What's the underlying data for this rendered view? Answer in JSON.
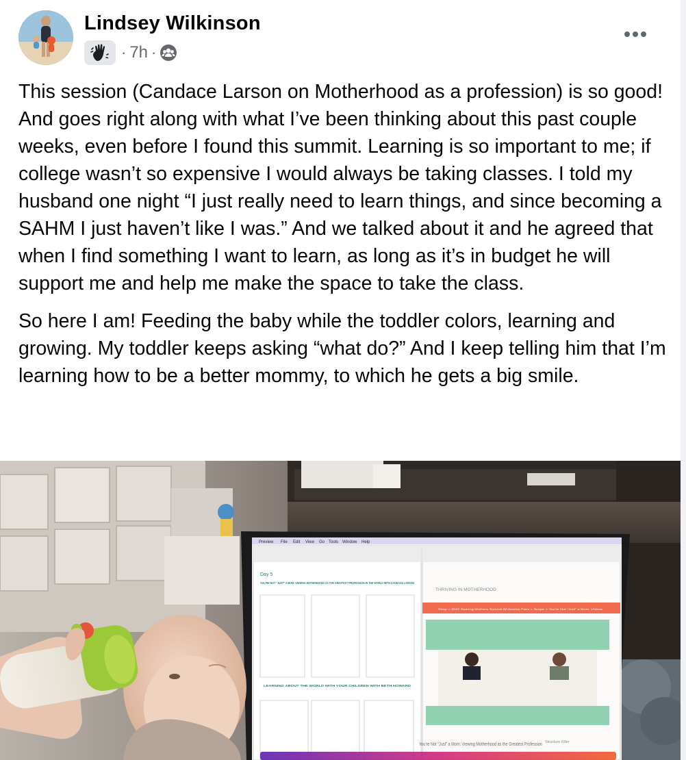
{
  "post": {
    "author": "Lindsey Wilkinson",
    "time": "7h",
    "separator": "·",
    "badge_icon": "wave-hand-icon",
    "audience_icon": "group-audience-icon",
    "menu_icon": "more-horizontal-icon",
    "paragraphs": [
      "This session (Candace Larson on Motherhood as a profession) is so good! And goes right along with what I’ve been thinking about this past couple weeks, even before I found this summit. Learning is so important to me; if college wasn’t so expensive I would always be taking classes. I told my husband one night “I just really need to learn things, and since becoming a SAHM I just haven’t like I was.” And we talked about it and he agreed that when I find something I want to learn, as long as it’s in budget he will support me and help me make the space to take the class.",
      "So here I am! Feeding the baby while the toddler colors, learning and growing. My toddler keeps asking “what do?” And I keep telling him that I’m learning how to be a better mommy, to which he gets a big smile."
    ]
  },
  "photo": {
    "workbook": {
      "day": "Day 5",
      "heading": "YOU’RE NOT “JUST” A MOM: VIEWING MOTHERHOOD AS THE GREATEST PROFESSION IN THE WORLD WITH CANDACE LARSON",
      "section": "LEARNING ABOUT THE WORLD WITH YOUR CHILDREN WITH BETH HOWARD"
    },
    "site": {
      "brand": "THRIVING IN MOTHERHOOD",
      "breadcrumb": "Shop  >  2022 Soaring Mothers Summit All Access Pass  >  Scope  >  You’re Not “Just” a Mom: Videos",
      "video_title": "You’re Not “Just” a Mom: Viewing Motherhood as the Greatest Profession",
      "side_label": "Structure Filler"
    },
    "menubar": [
      "Preview",
      "File",
      "Edit",
      "View",
      "Go",
      "Tools",
      "Window",
      "Help"
    ]
  }
}
